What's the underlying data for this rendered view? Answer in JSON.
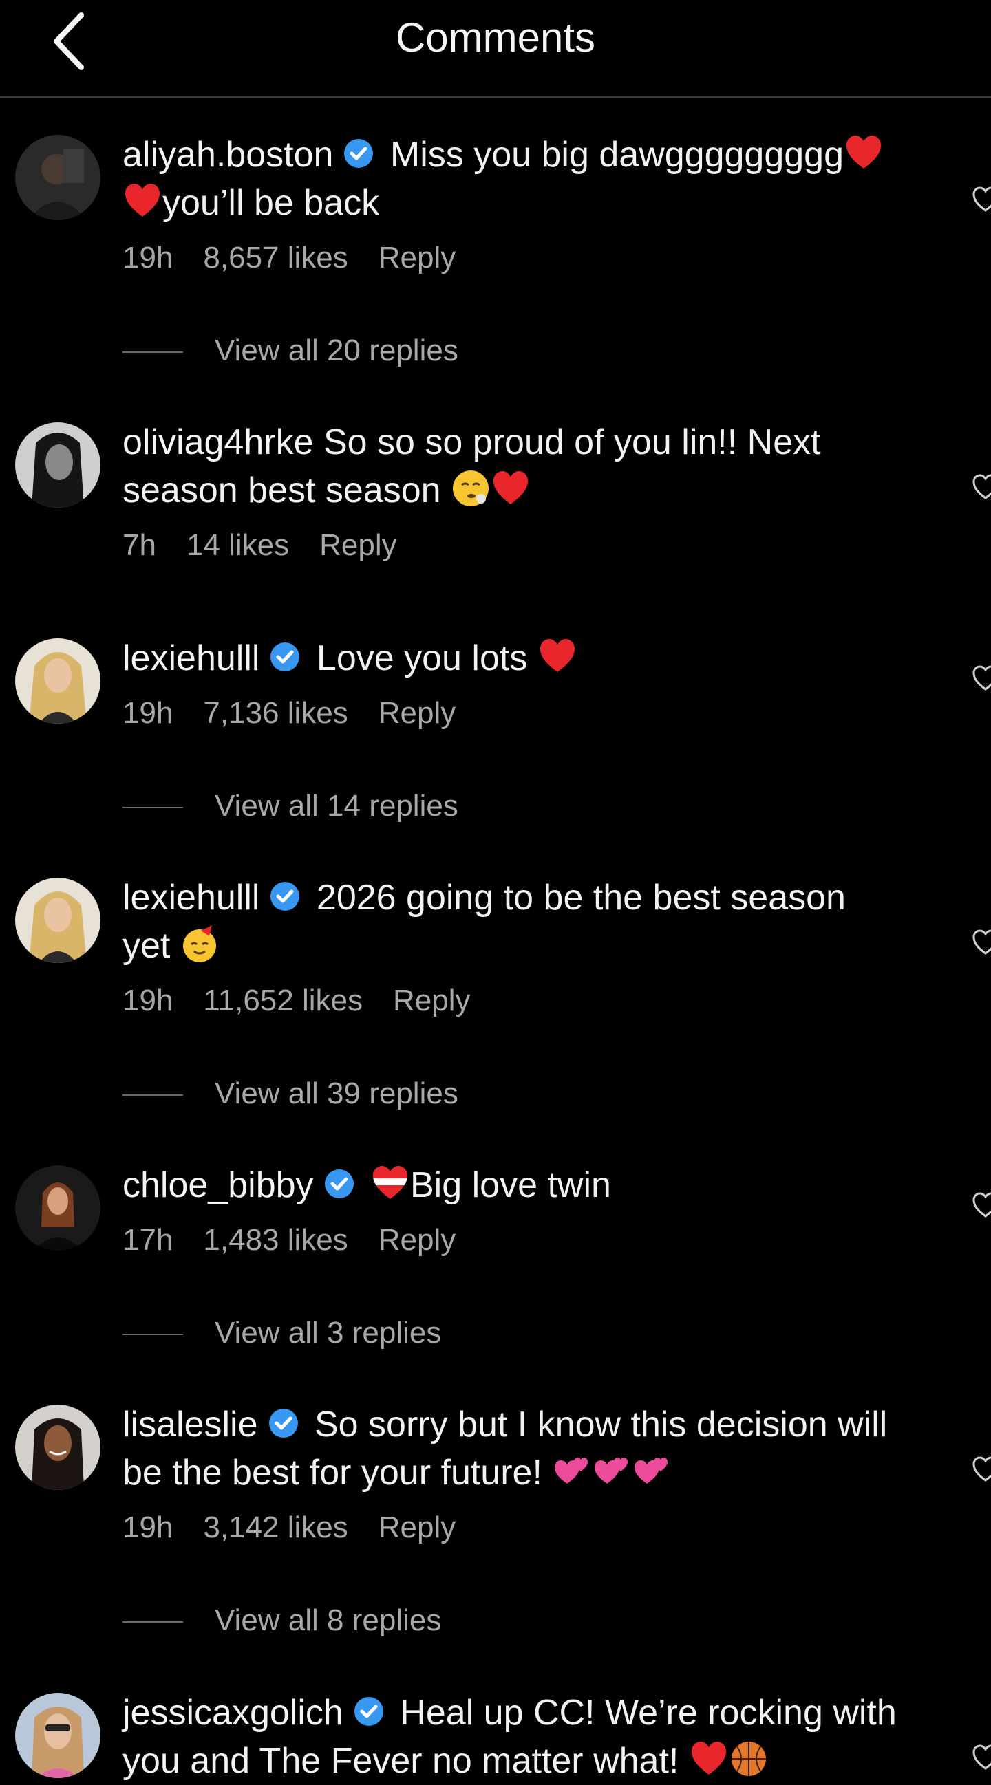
{
  "header": {
    "title": "Comments",
    "back_icon": "chevron-left-icon"
  },
  "comments": [
    {
      "username": "aliyah.boston",
      "verified": true,
      "text": "Miss you big dawggggggggg",
      "text2": "you’ll be back",
      "time": "19h",
      "likes": "8,657 likes",
      "reply": "Reply",
      "view_replies": "View all 20 replies"
    },
    {
      "username": "oliviag4hrke",
      "verified": false,
      "text": "So so so proud of you lin!! Next",
      "text2": "season best season",
      "time": "7h",
      "likes": "14 likes",
      "reply": "Reply"
    },
    {
      "username": "lexiehulll",
      "verified": true,
      "text": "Love you lots",
      "time": "19h",
      "likes": "7,136 likes",
      "reply": "Reply",
      "view_replies": "View all 14 replies"
    },
    {
      "username": "lexiehulll",
      "verified": true,
      "text": "2026 going to be the best season",
      "text2": "yet",
      "time": "19h",
      "likes": "11,652 likes",
      "reply": "Reply",
      "view_replies": "View all 39 replies"
    },
    {
      "username": "chloe_bibby",
      "verified": true,
      "text": "Big love twin",
      "time": "17h",
      "likes": "1,483 likes",
      "reply": "Reply",
      "view_replies": "View all 3 replies"
    },
    {
      "username": "lisaleslie",
      "verified": true,
      "text": "So sorry but I know this decision will",
      "text2": "be the best for your future!",
      "time": "19h",
      "likes": "3,142 likes",
      "reply": "Reply",
      "view_replies": "View all 8 replies"
    },
    {
      "username": "jessicaxgolich",
      "verified": true,
      "text": "Heal up CC! We’re rocking with",
      "text2": "you and The Fever no matter what!"
    }
  ],
  "colors": {
    "background": "#000000",
    "text": "#f2f2f2",
    "secondary_text": "#a8a8a8",
    "verified_blue": "#3897f0",
    "heart_red": "#e8262c"
  }
}
